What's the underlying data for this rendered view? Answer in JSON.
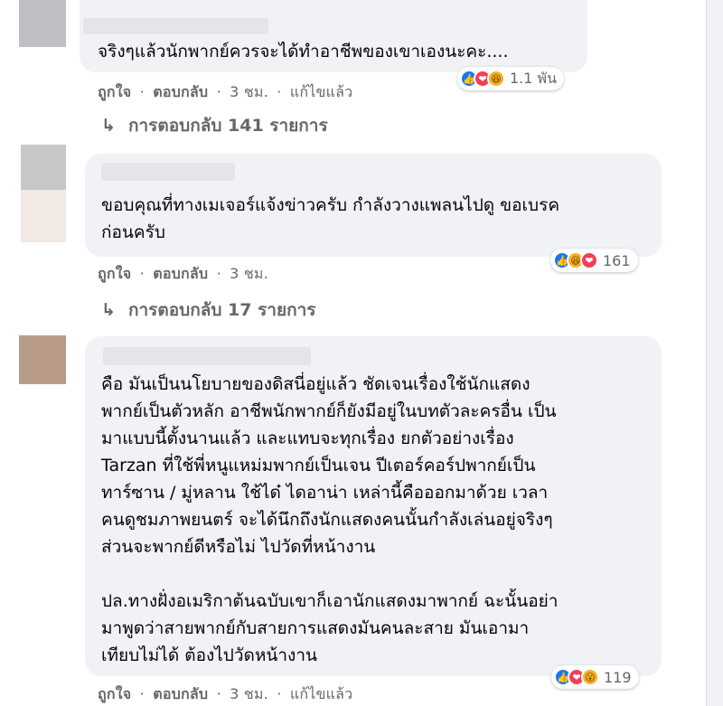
{
  "comments": [
    {
      "text": "จริงๆแล้วนักพากย์ควรจะได้ทำอาชีพของเขาเองนะคะ....",
      "actions": {
        "like": "ถูกใจ",
        "reply": "ตอบกลับ",
        "time": "3 ชม.",
        "edited": "แก้ไขแล้ว"
      },
      "reactions": {
        "icons": [
          "like-icon",
          "love-icon",
          "haha-icon"
        ],
        "count": "1.1 พัน"
      },
      "replies_label": "การตอบกลับ 141 รายการ"
    },
    {
      "text": "ขอบคุณที่ทางเมเจอร์แจ้งข่าวครับ กำลังวางแพลนไปดู ขอเบรค\nก่อนครับ",
      "actions": {
        "like": "ถูกใจ",
        "reply": "ตอบกลับ",
        "time": "3 ชม."
      },
      "reactions": {
        "icons": [
          "like-icon",
          "haha-icon",
          "love-icon"
        ],
        "count": "161"
      },
      "replies_label": "การตอบกลับ 17 รายการ"
    },
    {
      "text": "คือ มันเป็นนโยบายของดิสนี่อยู่แล้ว ชัดเจนเรื่องใช้นักแสดง\nพากย์เป็นตัวหลัก อาชีพนักพากย์ก็ยังมีอยู่ในบทตัวละครอื่น เป็น\nมาแบบนี้ตั้งนานแล้ว และแทบจะทุกเรื่อง ยกตัวอย่างเรื่อง\nTarzan ที่ใช้พี่หนูแหม่มพากย์เป็นเจน ปีเตอร์คอร์ปพากย์เป็น\nทาร์ซาน / มู่หลาน ใช้ได๋ ไดอาน่า เหล่านี้คือออกมาด้วย เวลา\nคนดูชมภาพยนตร์ จะได้นึกถึงนักแสดงคนนั้นกำลังเล่นอยู่จริงๆ\nส่วนจะพากย์ดีหรือไม่ ไปวัดที่หน้างาน",
      "text2": "ปล.ทางฝั่งอเมริกาต้นฉบับเขาก็เอานักแสดงมาพากย์ ฉะนั้นอย่า\nมาพูดว่าสายพากย์กับสายการแสดงมันคนละสาย มันเอามา\nเทียบไม่ได้ ต้องไปวัดหน้างาน",
      "actions": {
        "like": "ถูกใจ",
        "reply": "ตอบกลับ",
        "time": "3 ชม.",
        "edited": "แก้ไขแล้ว"
      },
      "reactions": {
        "icons": [
          "like-icon",
          "love-icon",
          "wow-icon"
        ],
        "count": "119"
      }
    }
  ],
  "separator": "·",
  "colors": {
    "bubble": "#f0f2f5",
    "meta": "#65676b",
    "like": "#1877f2",
    "love": "#f33e58",
    "haha": "#f7b125"
  }
}
